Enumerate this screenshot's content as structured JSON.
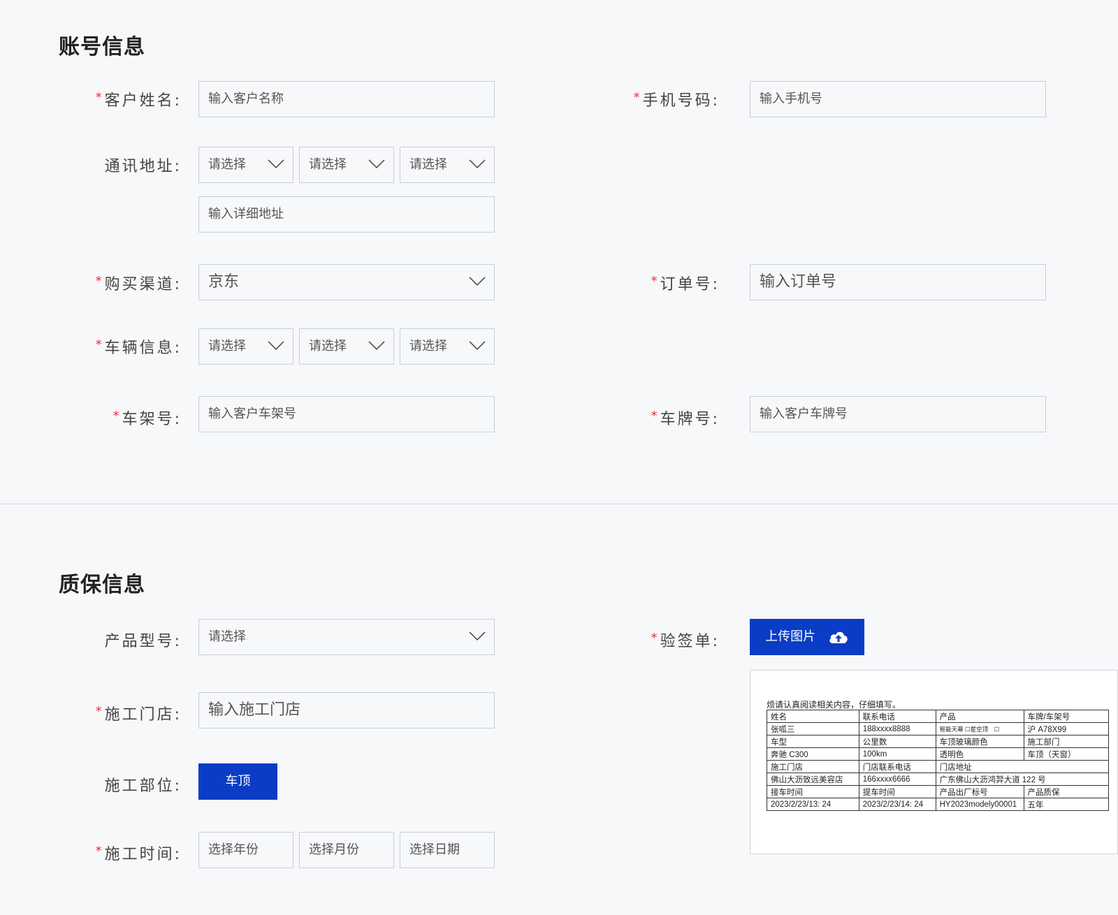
{
  "account_section": {
    "title": "账号信息",
    "customer_name": {
      "label": "客户姓名:",
      "placeholder": "输入客户名称"
    },
    "phone": {
      "label": "手机号码:",
      "placeholder": "输入手机号"
    },
    "address": {
      "label": "通讯地址:",
      "select1": "请选择",
      "select2": "请选择",
      "select3": "请选择",
      "detail_placeholder": "输入详细地址"
    },
    "channel": {
      "label": "购买渠道:",
      "value": "京东"
    },
    "order": {
      "label": "订单号:",
      "placeholder": "输入订单号"
    },
    "vehicle": {
      "label": "车辆信息:",
      "select1": "请选择",
      "select2": "请选择",
      "select3": "请选择"
    },
    "vin": {
      "label": "车架号:",
      "placeholder": "输入客户车架号"
    },
    "plate": {
      "label": "车牌号:",
      "placeholder": "输入客户车牌号"
    }
  },
  "warranty_section": {
    "title": "质保信息",
    "product_model": {
      "label": "产品型号:",
      "value": "请选择"
    },
    "inspection": {
      "label": "验签单:",
      "upload_label": "上传图片"
    },
    "store": {
      "label": "施工门店:",
      "placeholder": "输入施工门店"
    },
    "part": {
      "label": "施工部位:",
      "button": "车顶"
    },
    "time": {
      "label": "施工时间:",
      "year": "选择年份",
      "month": "选择月份",
      "day": "选择日期"
    }
  },
  "required_mark": "*",
  "colors": {
    "accent": "#0a3cc6",
    "required": "#e8323c",
    "border": "#c9ced6"
  },
  "sample_doc": {
    "note": "烦请认真阅读相关内容，仔细填写。",
    "rows": [
      [
        "姓名",
        "联系电话",
        "产品",
        "车牌/车架号"
      ],
      [
        "张呱三",
        "188xxxx8888",
        "智能天幕 ☐星空顶　☐",
        "沪 A78X99"
      ],
      [
        "车型",
        "公里数",
        "车顶玻璃颜色",
        "施工部门"
      ],
      [
        "奔驰 C300",
        "100km",
        "透明色",
        "车顶（天窗）"
      ],
      [
        "施工门店",
        "门店联系电话",
        "门店地址",
        ""
      ],
      [
        "佛山大沥致远美容店",
        "166xxxx6666",
        "广东佛山大沥鸿羿大道 122 号",
        ""
      ],
      [
        "接车时间",
        "提车时间",
        "产品出厂标号",
        "产品质保"
      ],
      [
        "2023/2/23/13:  24",
        "2023/2/23/14:  24",
        "HY2023modely00001",
        "五年"
      ]
    ]
  }
}
